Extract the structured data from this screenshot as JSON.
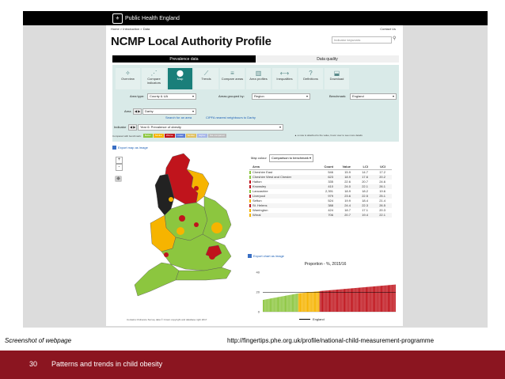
{
  "browser": {
    "site_name": "Public Health England"
  },
  "page": {
    "breadcrumb": "Home  >  Introduction  >  Data",
    "contact": "Contact Us",
    "title": "NCMP Local Authority Profile",
    "search_placeholder": "Indicator keywords"
  },
  "tabs": [
    {
      "label": "Prevalence data",
      "active": true
    },
    {
      "label": "Data quality",
      "active": false
    }
  ],
  "views": [
    {
      "label": "Overview",
      "icon": "overview-icon",
      "glyph": "✧"
    },
    {
      "label": "Compare indicators",
      "icon": "compare-indicators-icon",
      "glyph": "⋰"
    },
    {
      "label": "Map",
      "icon": "map-pin-icon",
      "glyph": "⬤",
      "active": true
    },
    {
      "label": "Trends",
      "icon": "trends-icon",
      "glyph": "⟋"
    },
    {
      "label": "Compare areas",
      "icon": "compare-areas-icon",
      "glyph": "≡"
    },
    {
      "label": "Area profiles",
      "icon": "area-profiles-icon",
      "glyph": "▥"
    },
    {
      "label": "Inequalities",
      "icon": "inequalities-icon",
      "glyph": "⟷"
    },
    {
      "label": "Definitions",
      "icon": "definitions-icon",
      "glyph": "?"
    },
    {
      "label": "Download",
      "icon": "download-icon",
      "glyph": "⬓"
    }
  ],
  "filters": {
    "area_type_label": "Area type:",
    "area_type_value": "County & UA",
    "grouped_label": "Areas grouped by:",
    "grouped_value": "Region",
    "benchmark_label": "Benchmark:",
    "benchmark_value": "England",
    "area_label": "Area",
    "area_value": "Darby",
    "search_area_link": "Search for an area",
    "cipfa_link": "CIPFA nearest neighbours to Darby",
    "indicator_label": "Indicator",
    "indicator_value": "Year 6: Prevalence of obesity"
  },
  "benchmark_legend": {
    "label": "Compared with benchmark:",
    "chips": [
      {
        "text": "Better",
        "color": "#8cc63f"
      },
      {
        "text": "Similar",
        "color": "#f6b400"
      },
      {
        "text": "Worse",
        "color": "#c0141c"
      },
      {
        "text": "Lower",
        "color": "#5b7bd6"
      },
      {
        "text": "Similar",
        "color": "#e0c060"
      },
      {
        "text": "Higher",
        "color": "#a7b6e8"
      },
      {
        "text": "Not compared",
        "color": "#bbbbbb"
      }
    ],
    "note": "▲ a note is attached to the value, hover over to see more details"
  },
  "map": {
    "export_label": "Export map as image",
    "zoom_in": "+",
    "zoom_out": "-",
    "attribution": "Contains Ordnance Survey data © Crown copyright and database right 2017"
  },
  "map_colour": {
    "label": "Map colour",
    "value": "Comparison to benchmark"
  },
  "area_table": {
    "headers": [
      "Area",
      "Count",
      "Value",
      "LCI",
      "UCI"
    ],
    "rows": [
      {
        "area": "Cheshire East",
        "count": "546",
        "value": "15.9",
        "lci": "14.7",
        "uci": "17.2",
        "color": "#8cc63f"
      },
      {
        "area": "Cheshire West and Chester",
        "count": "623",
        "value": "18.9",
        "lci": "17.6",
        "uci": "20.2",
        "color": "#8cc63f"
      },
      {
        "area": "Halton",
        "count": "335",
        "value": "22.6",
        "lci": "20.7",
        "uci": "24.6",
        "color": "#c0141c"
      },
      {
        "area": "Knowsley",
        "count": "410",
        "value": "24.0",
        "lci": "22.1",
        "uci": "26.1",
        "color": "#c0141c"
      },
      {
        "area": "Lancashire",
        "count": "2,391",
        "value": "18.9",
        "lci": "18.2",
        "uci": "19.6",
        "color": "#8cc63f"
      },
      {
        "area": "Liverpool",
        "count": "979",
        "value": "23.6",
        "lci": "22.5",
        "uci": "25.1",
        "color": "#c0141c"
      },
      {
        "area": "Sefton",
        "count": "524",
        "value": "19.9",
        "lci": "18.4",
        "uci": "21.4",
        "color": "#f6b400"
      },
      {
        "area": "St. Helens",
        "count": "388",
        "value": "24.4",
        "lci": "22.3",
        "uci": "26.5",
        "color": "#c0141c"
      },
      {
        "area": "Warrington",
        "count": "424",
        "value": "18.7",
        "lci": "17.1",
        "uci": "20.3",
        "color": "#f6b400"
      },
      {
        "area": "Wirral",
        "count": "706",
        "value": "20.7",
        "lci": "19.4",
        "uci": "22.1",
        "color": "#f6b400"
      }
    ]
  },
  "chart_export_label": "Export chart as image",
  "chart_data": {
    "type": "bar",
    "title": "Proportion - %, 2015/16",
    "ylim": [
      0,
      40
    ],
    "yticks": [
      "0",
      "20",
      "40"
    ],
    "legend": "England",
    "benchmark": 19.8,
    "groups": [
      {
        "count": 40,
        "from": 12.0,
        "to": 18.5,
        "color": "#8cc63f"
      },
      {
        "count": 24,
        "from": 18.6,
        "to": 20.8,
        "color": "#f6b400"
      },
      {
        "count": 86,
        "from": 20.9,
        "to": 27.5,
        "color": "#c0141c"
      }
    ]
  },
  "slide": {
    "caption_left": "Screenshot of webpage",
    "caption_right": "http://fingertips.phe.org.uk/profile/national-child-measurement-programme",
    "number": "30",
    "footer_title": "Patterns and trends in child obesity",
    "footer_color": "#8b1520"
  }
}
